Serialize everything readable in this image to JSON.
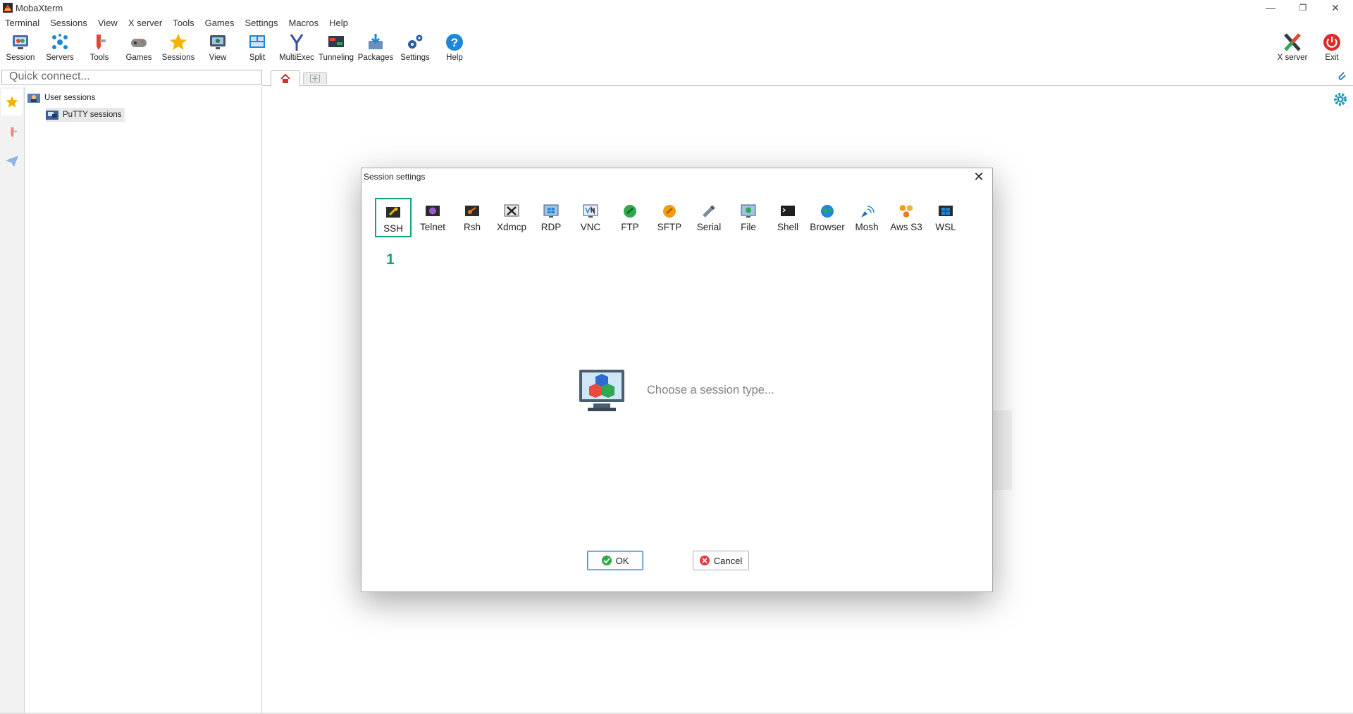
{
  "window": {
    "title": "MobaXterm",
    "minimize_glyph": "—",
    "restore_glyph": "❐",
    "close_glyph": "✕"
  },
  "menu": [
    "Terminal",
    "Sessions",
    "View",
    "X server",
    "Tools",
    "Games",
    "Settings",
    "Macros",
    "Help"
  ],
  "toolbar": {
    "left": [
      {
        "label": "Session",
        "icon": "session-icon"
      },
      {
        "label": "Servers",
        "icon": "servers-icon"
      },
      {
        "label": "Tools",
        "icon": "tools-icon"
      },
      {
        "label": "Games",
        "icon": "games-icon"
      },
      {
        "label": "Sessions",
        "icon": "star-icon"
      },
      {
        "label": "View",
        "icon": "view-icon"
      },
      {
        "label": "Split",
        "icon": "split-icon"
      },
      {
        "label": "MultiExec",
        "icon": "multiexec-icon"
      },
      {
        "label": "Tunneling",
        "icon": "tunneling-icon"
      },
      {
        "label": "Packages",
        "icon": "packages-icon"
      },
      {
        "label": "Settings",
        "icon": "settings-icon"
      },
      {
        "label": "Help",
        "icon": "help-icon"
      }
    ],
    "right": [
      {
        "label": "X server",
        "icon": "xserver-icon"
      },
      {
        "label": "Exit",
        "icon": "power-icon"
      }
    ]
  },
  "quick_connect": {
    "placeholder": "Quick connect..."
  },
  "sidebar": {
    "tree": [
      {
        "label": "User sessions"
      },
      {
        "label": "PuTTY sessions"
      }
    ]
  },
  "dialog": {
    "title": "Session settings",
    "close_glyph": "✕",
    "session_types": [
      "SSH",
      "Telnet",
      "Rsh",
      "Xdmcp",
      "RDP",
      "VNC",
      "FTP",
      "SFTP",
      "Serial",
      "File",
      "Shell",
      "Browser",
      "Mosh",
      "Aws S3",
      "WSL"
    ],
    "selected_type": "SSH",
    "step_marker": "1",
    "hint": "Choose a session type...",
    "ok_label": "OK",
    "cancel_label": "Cancel"
  },
  "colors": {
    "highlight": "#12a37a",
    "ok_border": "#4a8dcc",
    "cancel_icon": "#e0383e",
    "ok_icon": "#2fa84f"
  }
}
